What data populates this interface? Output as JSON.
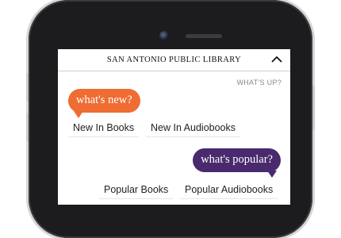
{
  "header": {
    "title": "SAN ANTONIO PUBLIC LIBRARY"
  },
  "section_label": "WHAT'S UP?",
  "new_section": {
    "bubble_label": "what's new?",
    "links": [
      "New In Books",
      "New In Audiobooks"
    ]
  },
  "popular_section": {
    "bubble_label": "what's popular?",
    "links": [
      "Popular Books",
      "Popular Audiobooks"
    ]
  },
  "colors": {
    "new_accent": "#ef6c33",
    "popular_accent": "#4a2a6e"
  },
  "icons": {
    "collapse": "chevron-up-icon"
  }
}
